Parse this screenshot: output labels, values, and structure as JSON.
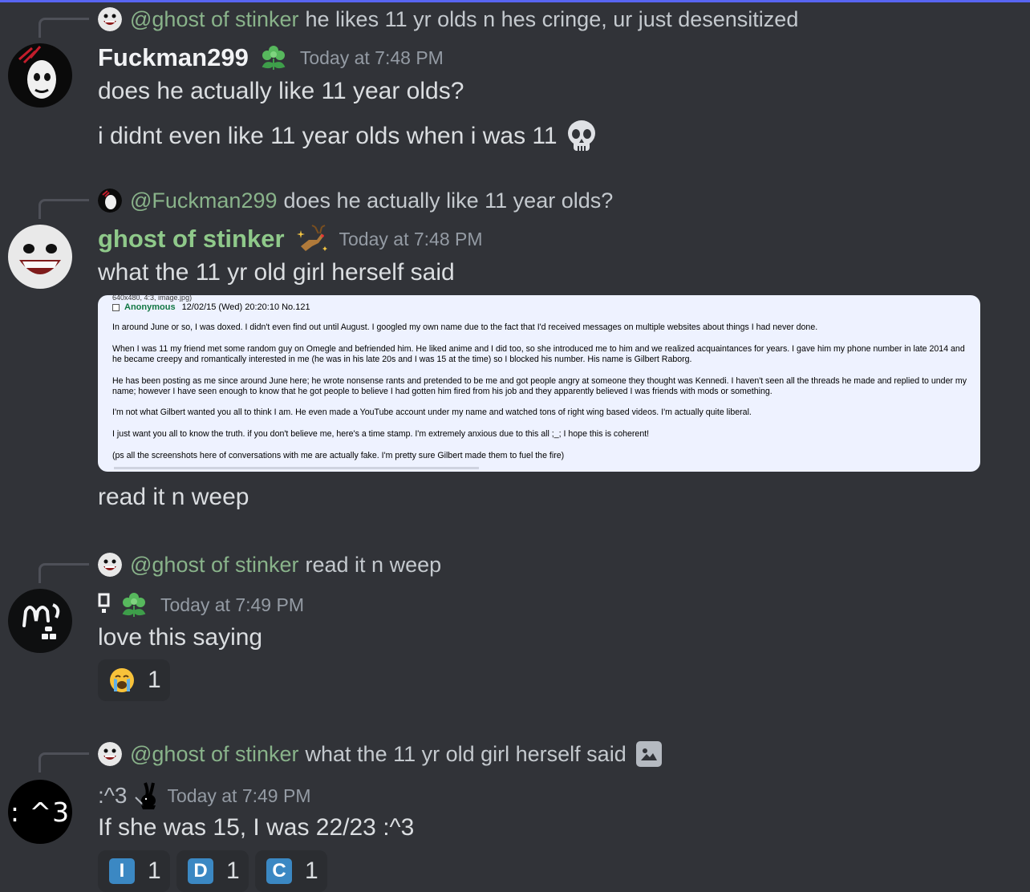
{
  "messages": [
    {
      "reply": {
        "mention": "@ghost of stinker",
        "text": "he likes 11 yr olds n hes cringe, ur just desensitized"
      },
      "username": "Fuckman299",
      "badge": "green-flower-badge",
      "timestamp": "Today at 7:48 PM",
      "lines": [
        "does he actually like 11 year olds?",
        "i didnt even like 11 year olds when i was 11"
      ]
    },
    {
      "reply": {
        "mention": "@Fuckman299",
        "text": "does he actually like 11 year olds?"
      },
      "username": "ghost of stinker",
      "badge": "sparkle-reindeer-badge",
      "timestamp": "Today at 7:48 PM",
      "lines": [
        "what the 11 yr old girl herself said",
        "read it n weep"
      ],
      "embed": {
        "meta": "640x480, 4:3, image.jpg)",
        "poster": "Anonymous",
        "post_info": "12/02/15 (Wed) 20:20:10 No.121",
        "paragraphs": [
          "In around June or so, I was doxed. I didn't even find out until August. I googled my own name due to the fact that I'd received messages on multiple websites about things I had never done.",
          "When I was 11 my friend met some random guy on Omegle and befriended him. He liked anime and I did too, so she introduced me to him and we realized acquaintances for years. I gave him my phone number in late 2014 and he became creepy and romantically interested in me (he was in his late 20s and I was 15 at the time) so I blocked his number. His name is Gilbert Raborg.",
          "He has been posting as me since around June here; he wrote nonsense rants and pretended to be me and got people angry at someone they thought was Kennedi. I haven't seen all the threads he made and replied to under my name; however I have seen enough to know that he got people to believe I had gotten him fired from his job and they apparently believed I was friends with mods or something.",
          "I'm not what Gilbert wanted you all to think I am. He even made a YouTube account under my name and watched tons of right wing based videos. I'm actually quite liberal.",
          "I just want you all to know the truth. if you don't believe me, here's a time stamp. I'm extremely anxious due to this all ;_; I hope this is coherent!",
          "(ps all the screenshots here of conversations with me are actually fake. I'm pretty sure Gilbert made them to fuel the fire)"
        ]
      }
    },
    {
      "reply": {
        "mention": "@ghost of stinker",
        "text": "read it n weep"
      },
      "username": "",
      "badge": "green-flower-badge",
      "timestamp": "Today at 7:49 PM",
      "lines": [
        "love this saying"
      ],
      "reactions": [
        {
          "emoji": "loudly-crying-face",
          "count": "1"
        }
      ]
    },
    {
      "reply": {
        "mention": "@ghost of stinker",
        "text": "what the 11 yr old girl herself said"
      },
      "username": ":^3",
      "badge": "playboy-bunny-badge",
      "timestamp": "Today at 7:49 PM",
      "lines": [
        "If she was 15, I was 22/23 :^3"
      ],
      "avatar_text": ": ^3",
      "reactions": [
        {
          "emoji": "regional-indicator-i",
          "letter": "I",
          "count": "1"
        },
        {
          "emoji": "regional-indicator-d",
          "letter": "D",
          "count": "1"
        },
        {
          "emoji": "regional-indicator-c",
          "letter": "C",
          "count": "1"
        }
      ]
    }
  ],
  "colors": {
    "background": "#313338",
    "accent": "#5865f2",
    "mention": "#89b38a",
    "username_green": "#8fc98a",
    "timestamp": "#949ba4"
  }
}
